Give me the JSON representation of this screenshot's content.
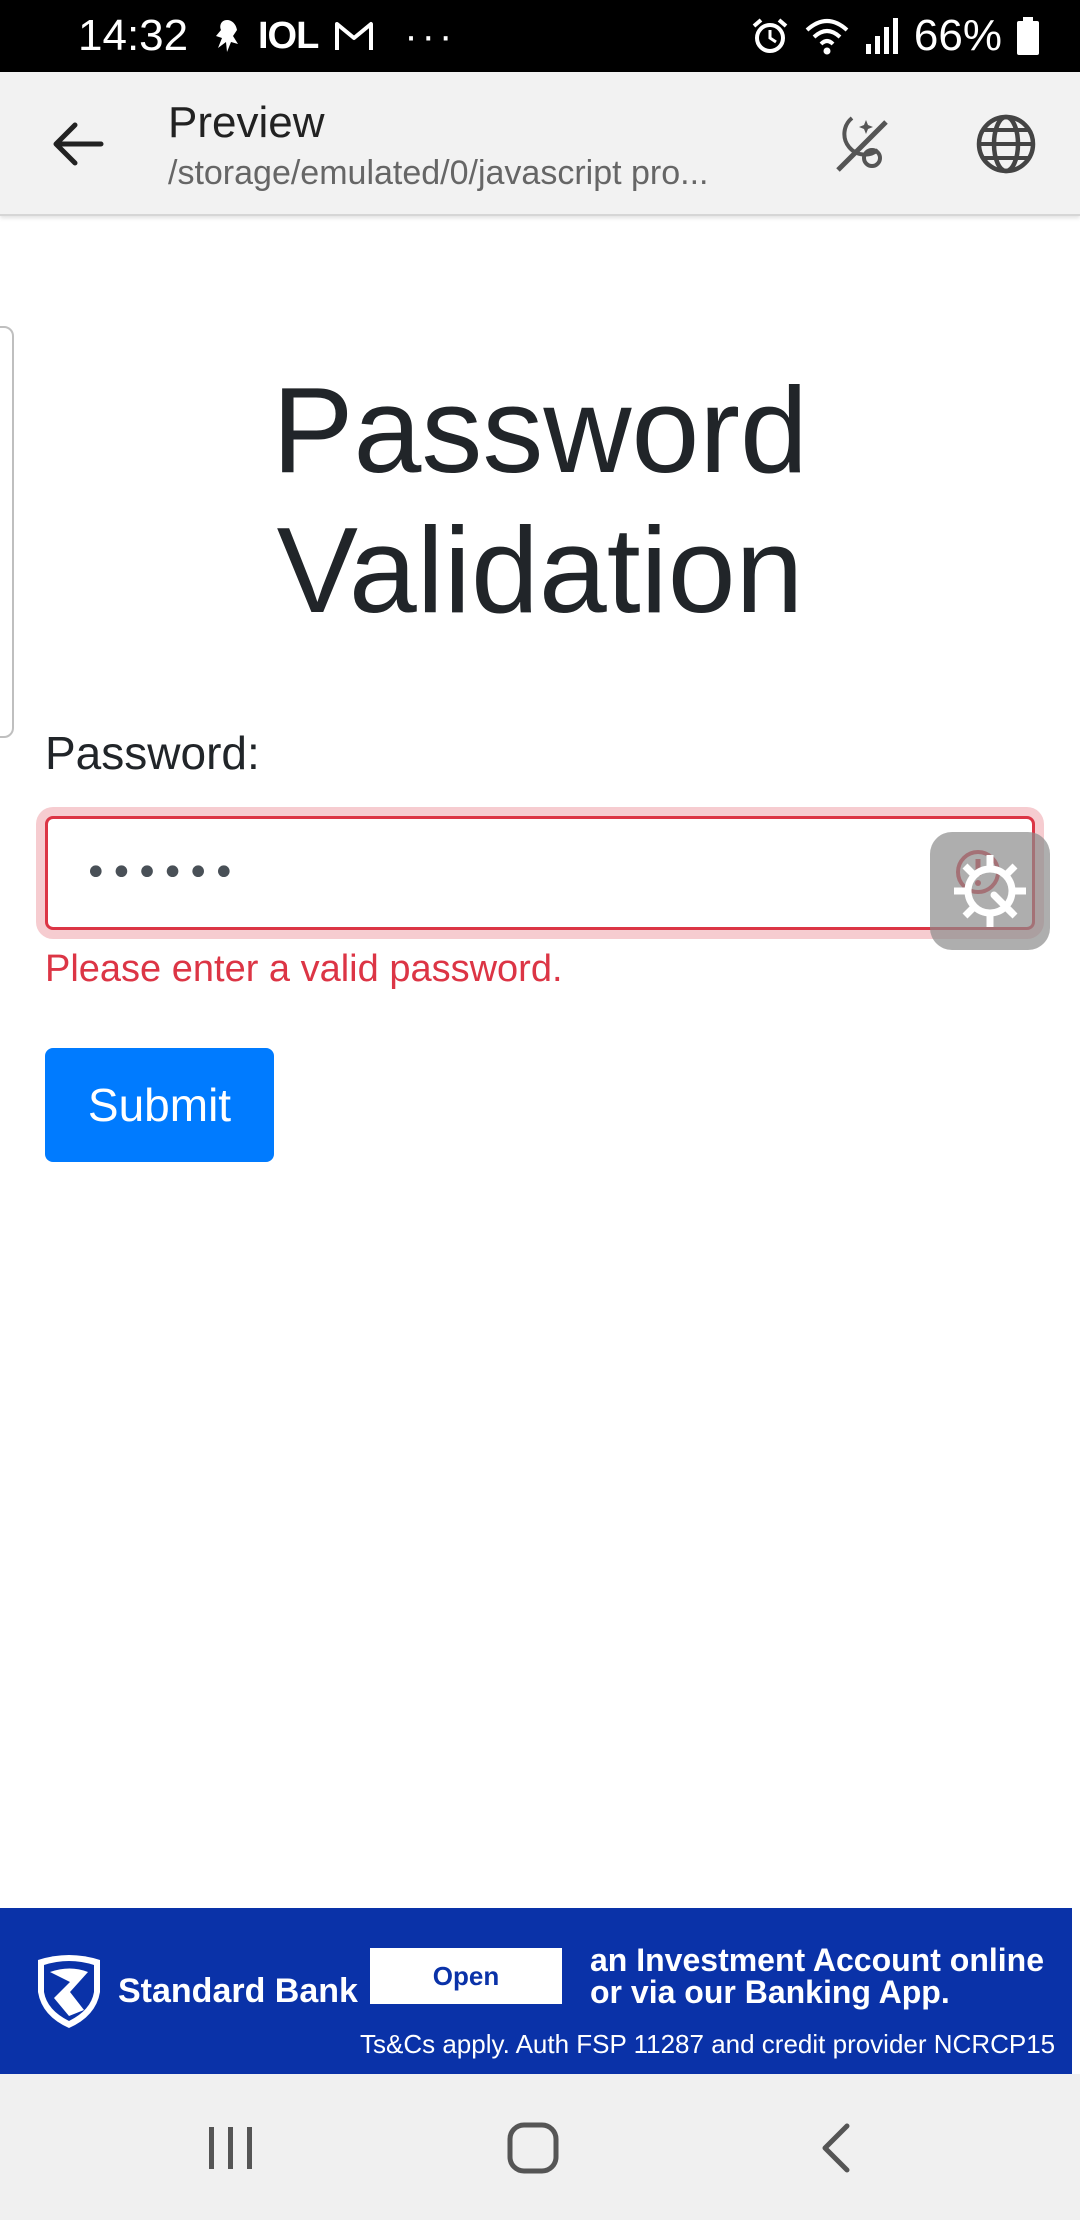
{
  "status_bar": {
    "time": "14:32",
    "carrier_text": "IOL",
    "more": "···",
    "battery": "66%"
  },
  "app_bar": {
    "title": "Preview",
    "subtitle": "/storage/emulated/0/javascript pro..."
  },
  "form": {
    "title": "Password Validation",
    "label": "Password:",
    "value": "••••••",
    "feedback": "Please enter a valid password.",
    "submit_label": "Submit"
  },
  "ad": {
    "brand": "Standard Bank",
    "open_label": "Open",
    "headline": "an Investment Account online or via our Banking App.",
    "fine_print": "Ts&Cs apply. Auth FSP 11287 and credit provider NCRCP15"
  },
  "colors": {
    "primary": "#007bff",
    "danger": "#dc3545",
    "ad_background": "#0a32a8"
  }
}
